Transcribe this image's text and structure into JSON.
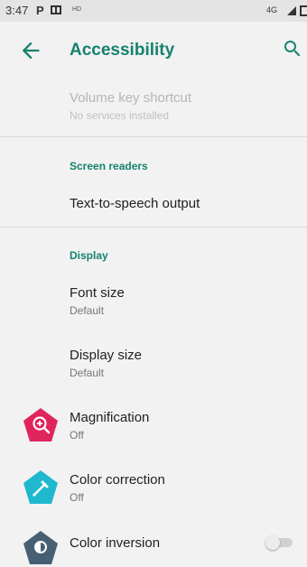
{
  "status_bar": {
    "time": "3:47",
    "p_label": "P",
    "hd_label": "HD",
    "network": "4G"
  },
  "app_bar": {
    "title": "Accessibility",
    "back_icon": "arrow-back-icon",
    "search_icon": "search-icon",
    "accent_color": "#15826f"
  },
  "items": {
    "volume_key": {
      "title": "Volume key shortcut",
      "summary": "No services installed"
    },
    "screen_readers_header": "Screen readers",
    "tts": {
      "title": "Text-to-speech output"
    },
    "display_header": "Display",
    "font_size": {
      "title": "Font size",
      "summary": "Default"
    },
    "display_size": {
      "title": "Display size",
      "summary": "Default"
    },
    "magnification": {
      "title": "Magnification",
      "summary": "Off",
      "icon": "magnify-plus-icon",
      "color": "#e0245e"
    },
    "color_correction": {
      "title": "Color correction",
      "summary": "Off",
      "icon": "eyedropper-icon",
      "color": "#1fb8cf"
    },
    "color_inversion": {
      "title": "Color inversion",
      "icon": "invert-colors-icon",
      "color": "#465f73",
      "toggle_on": false
    }
  }
}
